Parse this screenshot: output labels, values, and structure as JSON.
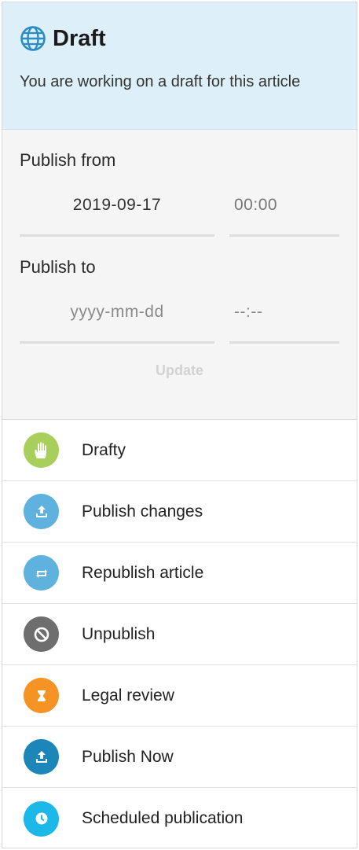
{
  "header": {
    "title": "Draft",
    "subtitle": "You are working on a draft for this article",
    "icon": "globe-icon"
  },
  "schedule": {
    "publish_from_label": "Publish from",
    "publish_from_date": "2019-09-17",
    "publish_from_time": "00:00",
    "publish_to_label": "Publish to",
    "publish_to_date_placeholder": "yyyy-mm-dd",
    "publish_to_time_placeholder": "--:--",
    "update_label": "Update"
  },
  "actions": [
    {
      "label": "Drafty",
      "icon": "hand-icon",
      "color": "#a8cf5c"
    },
    {
      "label": "Publish changes",
      "icon": "upload-icon",
      "color": "#5fb1de"
    },
    {
      "label": "Republish article",
      "icon": "repeat-icon",
      "color": "#5fb1de"
    },
    {
      "label": "Unpublish",
      "icon": "block-icon",
      "color": "#6e6e6e"
    },
    {
      "label": "Legal review",
      "icon": "hourglass-icon",
      "color": "#f59425"
    },
    {
      "label": "Publish Now",
      "icon": "upload-icon",
      "color": "#1c86b8"
    },
    {
      "label": "Scheduled publication",
      "icon": "clock-icon",
      "color": "#1cb8e8"
    }
  ]
}
